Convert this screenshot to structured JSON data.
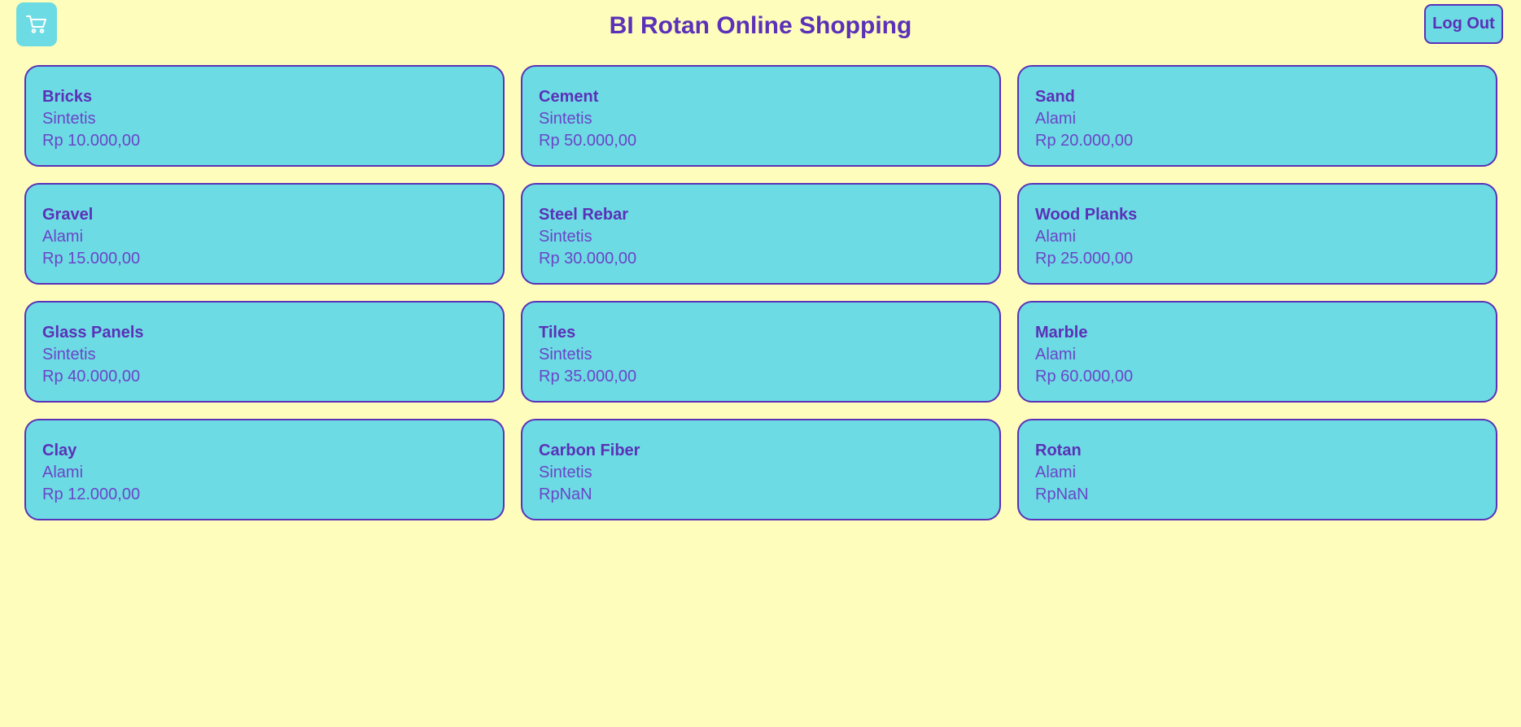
{
  "header": {
    "title": "BI Rotan Online Shopping",
    "logout_label": "Log Out",
    "cart_icon": "shopping-cart-icon"
  },
  "colors": {
    "background": "#fffdbb",
    "card": "#6ddbe3",
    "accent": "#5a31b8"
  },
  "products": [
    {
      "name": "Bricks",
      "type": "Sintetis",
      "price": "Rp 10.000,00"
    },
    {
      "name": "Cement",
      "type": "Sintetis",
      "price": "Rp 50.000,00"
    },
    {
      "name": "Sand",
      "type": "Alami",
      "price": "Rp 20.000,00"
    },
    {
      "name": "Gravel",
      "type": "Alami",
      "price": "Rp 15.000,00"
    },
    {
      "name": "Steel Rebar",
      "type": "Sintetis",
      "price": "Rp 30.000,00"
    },
    {
      "name": "Wood Planks",
      "type": "Alami",
      "price": "Rp 25.000,00"
    },
    {
      "name": "Glass Panels",
      "type": "Sintetis",
      "price": "Rp 40.000,00"
    },
    {
      "name": "Tiles",
      "type": "Sintetis",
      "price": "Rp 35.000,00"
    },
    {
      "name": "Marble",
      "type": "Alami",
      "price": "Rp 60.000,00"
    },
    {
      "name": "Clay",
      "type": "Alami",
      "price": "Rp 12.000,00"
    },
    {
      "name": "Carbon Fiber",
      "type": "Sintetis",
      "price": "RpNaN"
    },
    {
      "name": "Rotan",
      "type": "Alami",
      "price": "RpNaN"
    }
  ]
}
